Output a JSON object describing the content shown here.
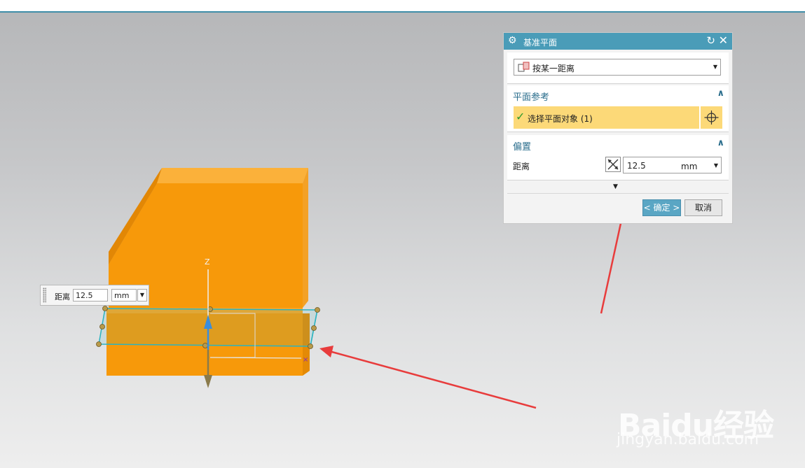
{
  "dialog": {
    "title": "基准平面",
    "type_select": "按某一距离",
    "plane_ref": {
      "heading": "平面参考",
      "selection": "选择平面对象 (1)"
    },
    "offset": {
      "heading": "偏置",
      "distance_label": "距离",
      "distance_value": "12.5",
      "unit": "mm"
    },
    "ok_label": "< 确定 >",
    "cancel_label": "取消"
  },
  "floating_input": {
    "label": "距离",
    "value": "12.5",
    "unit": "mm"
  },
  "scene": {
    "axis_label": "Z",
    "model_color": "#f7990a",
    "plane_color": "#2bb3c0"
  },
  "watermark": {
    "logo": "Baidu经验",
    "url": "jingyan.baidu.com"
  }
}
